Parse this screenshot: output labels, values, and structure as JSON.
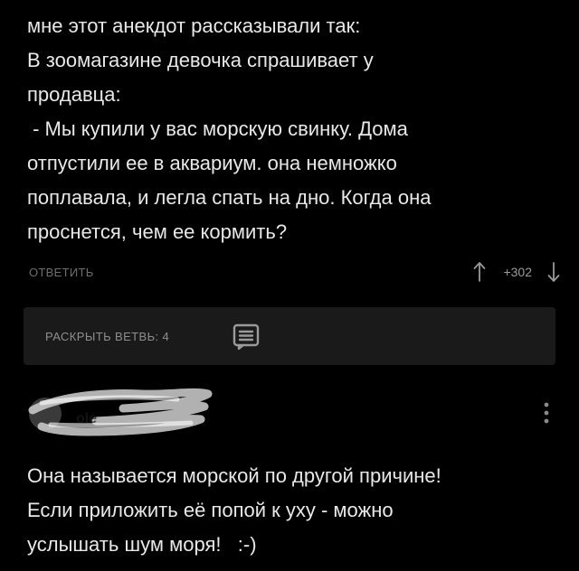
{
  "comment": {
    "lines": [
      "мне этот анекдот рассказывали так:",
      "В зоомагазине девочка спрашивает у",
      "продавца:",
      " - Мы купили у вас морскую свинку. Дома",
      "отпустили ее в аквариум. она немножко",
      "поплавала, и легла спать на дно. Когда она",
      "проснется, чем ее кормить?"
    ],
    "reply_label": "ОТВЕТИТЬ",
    "rating": "+302"
  },
  "thread": {
    "expand_label": "РАСКРЫТЬ ВЕТВЬ: 4",
    "icon": "comments-thread-icon"
  },
  "reply": {
    "author_masked_fragment": "ole",
    "lines": [
      "Она называется морской по другой причине!",
      "Если приложить её попой к уху - можно",
      "услышать шум моря!   :-)"
    ]
  },
  "colors": {
    "background": "#000000",
    "text": "#e8e8e8",
    "muted": "#6d6d6d",
    "panel": "#1a1a1a"
  }
}
